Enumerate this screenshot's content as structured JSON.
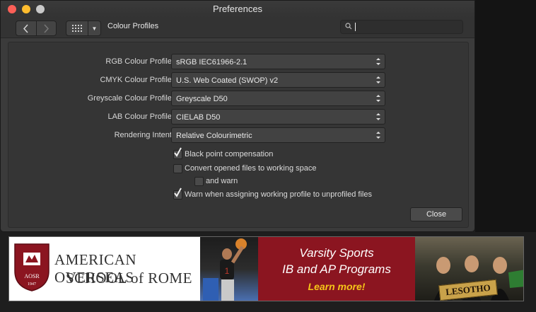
{
  "window": {
    "title": "Preferences"
  },
  "toolbar": {
    "section": "Colour Profiles",
    "search_value": ""
  },
  "profiles": [
    {
      "label": "RGB Colour Profile:",
      "value": "sRGB IEC61966-2.1"
    },
    {
      "label": "CMYK Colour Profile:",
      "value": "U.S. Web Coated (SWOP) v2"
    },
    {
      "label": "Greyscale Colour Profile:",
      "value": "Greyscale D50"
    },
    {
      "label": "LAB Colour Profile:",
      "value": "CIELAB D50"
    },
    {
      "label": "Rendering Intent:",
      "value": "Relative Colourimetric"
    }
  ],
  "options": {
    "black_point": {
      "label": "Black point compensation",
      "checked": true
    },
    "convert_opened": {
      "label": "Convert opened files to working space",
      "checked": false
    },
    "and_warn": {
      "label": "and warn",
      "checked": false
    },
    "warn_unprofiled": {
      "label": "Warn when assigning working profile to unprofiled files",
      "checked": true
    }
  },
  "footer": {
    "close_label": "Close"
  },
  "ad": {
    "school_line1": "AMERICAN OVERSEAS",
    "school_line2": "SCHOOL of ROME",
    "crest_letters": "AOSR",
    "crest_year": "1947",
    "promo_line1": "Varsity Sports",
    "promo_line2": "IB and AP Programs",
    "promo_cta": "Learn more!",
    "sign_text": "LESOTHO"
  },
  "colors": {
    "window_bg": "#3b3b3b",
    "ad_red": "#8b1520",
    "cta_yellow": "#f5c518"
  }
}
